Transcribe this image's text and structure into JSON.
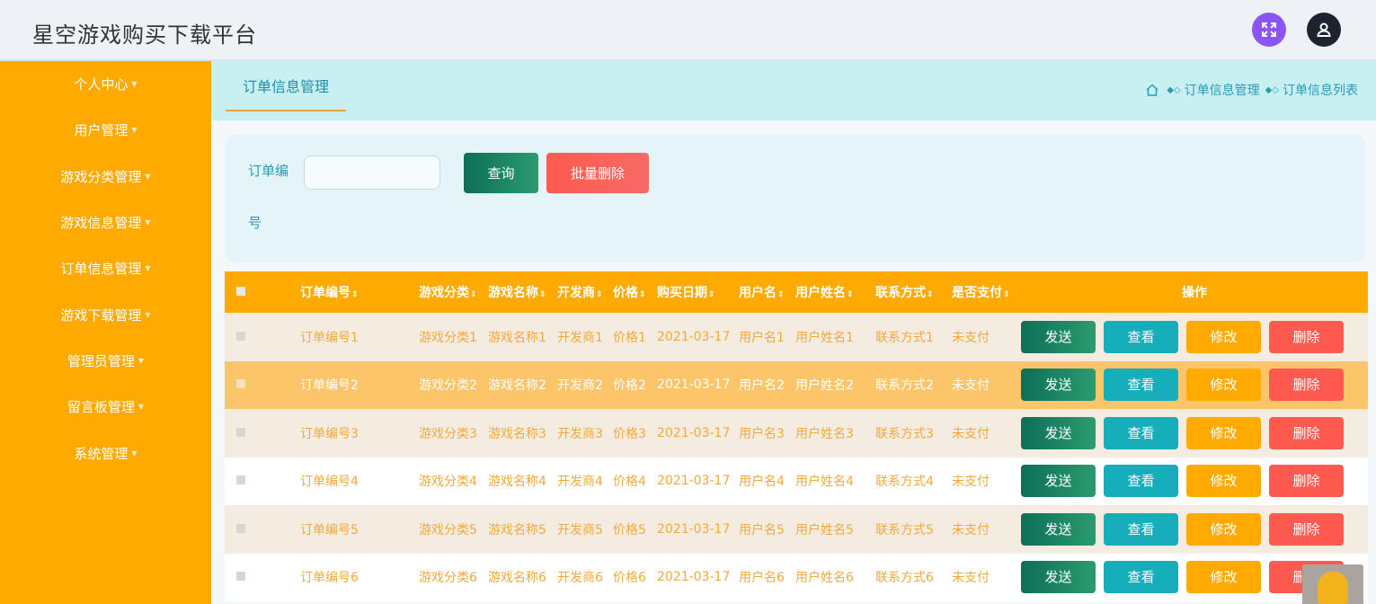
{
  "app": {
    "title": "星空游戏购买下载平台"
  },
  "header": {
    "fullscreen_icon": "expand-icon",
    "avatar_icon": "user-icon"
  },
  "sidebar": {
    "items": [
      {
        "label": "个人中心"
      },
      {
        "label": "用户管理"
      },
      {
        "label": "游戏分类管理"
      },
      {
        "label": "游戏信息管理"
      },
      {
        "label": "订单信息管理"
      },
      {
        "label": "游戏下载管理"
      },
      {
        "label": "管理员管理"
      },
      {
        "label": "留言板管理"
      },
      {
        "label": "系统管理"
      }
    ]
  },
  "tabs": {
    "active": "订单信息管理"
  },
  "breadcrumb": {
    "level1": "订单信息管理",
    "level2": "订单信息列表",
    "home_icon": "home-icon"
  },
  "search": {
    "label_line1": "订单编",
    "label_line2": "号",
    "value": "",
    "query_label": "查询",
    "batch_delete_label": "批量删除"
  },
  "table": {
    "headers": {
      "order_no": "订单编号",
      "category": "游戏分类",
      "game_name": "游戏名称",
      "developer": "开发商",
      "price": "价格",
      "date": "购买日期",
      "username": "用户名",
      "real_name": "用户姓名",
      "contact": "联系方式",
      "paid": "是否支付",
      "ops": "操作"
    },
    "sort_icon": "sort-icon",
    "actions": {
      "send": "发送",
      "view": "查看",
      "edit": "修改",
      "delete": "删除"
    },
    "rows": [
      {
        "order_no": "订单编号1",
        "category": "游戏分类1",
        "game_name": "游戏名称1",
        "developer": "开发商1",
        "price": "价格1",
        "date": "2021-03-17",
        "username": "用户名1",
        "real_name": "用户姓名1",
        "contact": "联系方式1",
        "paid": "未支付"
      },
      {
        "order_no": "订单编号2",
        "category": "游戏分类2",
        "game_name": "游戏名称2",
        "developer": "开发商2",
        "price": "价格2",
        "date": "2021-03-17",
        "username": "用户名2",
        "real_name": "用户姓名2",
        "contact": "联系方式2",
        "paid": "未支付"
      },
      {
        "order_no": "订单编号3",
        "category": "游戏分类3",
        "game_name": "游戏名称3",
        "developer": "开发商3",
        "price": "价格3",
        "date": "2021-03-17",
        "username": "用户名3",
        "real_name": "用户姓名3",
        "contact": "联系方式3",
        "paid": "未支付"
      },
      {
        "order_no": "订单编号4",
        "category": "游戏分类4",
        "game_name": "游戏名称4",
        "developer": "开发商4",
        "price": "价格4",
        "date": "2021-03-17",
        "username": "用户名4",
        "real_name": "用户姓名4",
        "contact": "联系方式4",
        "paid": "未支付"
      },
      {
        "order_no": "订单编号5",
        "category": "游戏分类5",
        "game_name": "游戏名称5",
        "developer": "开发商5",
        "price": "价格5",
        "date": "2021-03-17",
        "username": "用户名5",
        "real_name": "用户姓名5",
        "contact": "联系方式5",
        "paid": "未支付"
      },
      {
        "order_no": "订单编号6",
        "category": "游戏分类6",
        "game_name": "游戏名称6",
        "developer": "开发商6",
        "price": "价格6",
        "date": "2021-03-17",
        "username": "用户名6",
        "real_name": "用户姓名6",
        "contact": "联系方式6",
        "paid": "未支付"
      }
    ]
  },
  "colors": {
    "accent": "#ffaa00",
    "primary_green": "#0d6f57",
    "teal": "#17aebc",
    "danger": "#ff5a4f",
    "purple": "#8a55f2"
  }
}
